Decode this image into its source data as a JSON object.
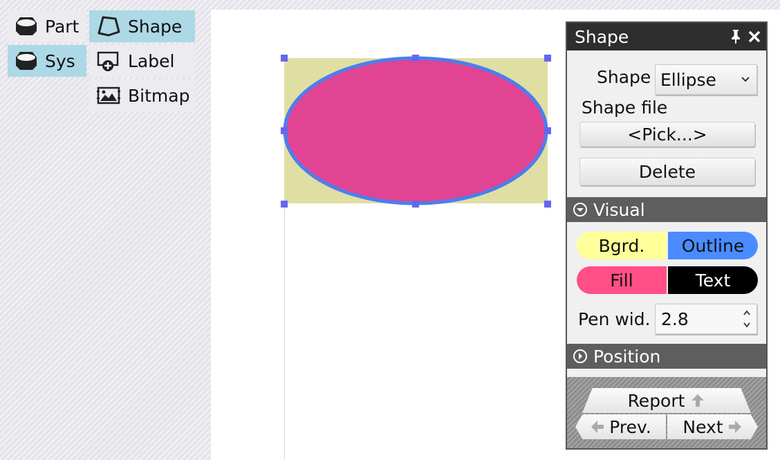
{
  "palette": {
    "part_label": "Part",
    "sys_label": "Sys",
    "shape_label": "Shape",
    "label_label": "Label",
    "bitmap_label": "Bitmap"
  },
  "canvas": {
    "shape_kind": "ellipse",
    "background_color": "#dfdfa3",
    "fill_color": "#e04493",
    "outline_color": "#4a7ef0",
    "handle_color": "#6666ee"
  },
  "panel": {
    "title": "Shape",
    "shape_label": "Shape",
    "shape_value": "Ellipse",
    "shape_file_label": "Shape file",
    "pick_button": "<Pick...>",
    "delete_button": "Delete",
    "visual_section": "Visual",
    "bgrd_button": "Bgrd.",
    "outline_button": "Outline",
    "fill_button": "Fill",
    "text_button": "Text",
    "pen_width_label": "Pen wid.",
    "pen_width_value": "2.8",
    "position_section": "Position",
    "report_button": "Report",
    "prev_button": "Prev.",
    "next_button": "Next",
    "colors": {
      "bgrd": "#ffff99",
      "outline": "#4a8cff",
      "fill": "#ff4f86",
      "text": "#000000"
    }
  }
}
